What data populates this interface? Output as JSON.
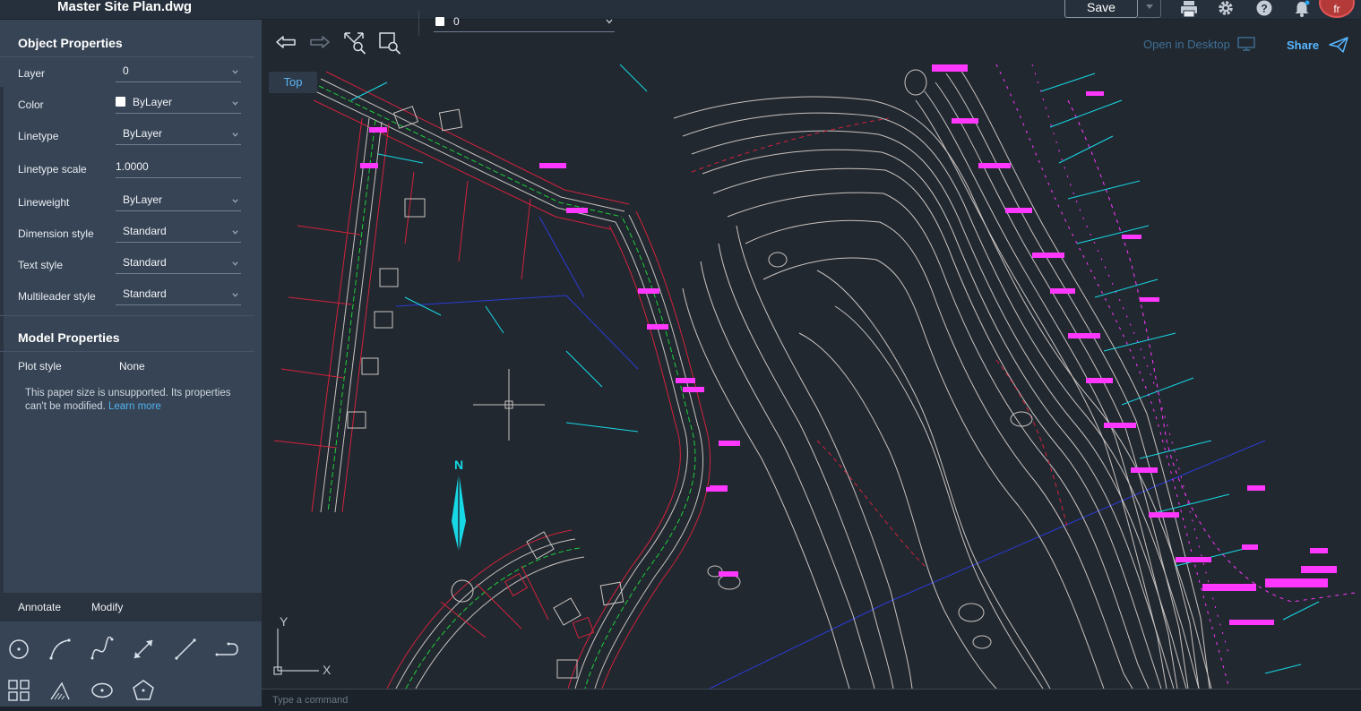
{
  "app": {
    "file_title": "Master Site Plan.dwg",
    "save_label": "Save",
    "avatar_initials": "fr",
    "open_desktop_label": "Open in Desktop",
    "share_label": "Share",
    "accent_color": "#58b6ff",
    "icons": [
      "print-icon",
      "gear-icon",
      "help-icon",
      "bell-icon"
    ]
  },
  "object_properties": {
    "title": "Object Properties",
    "rows": [
      {
        "label": "Layer",
        "value": "0"
      },
      {
        "label": "Color",
        "value": "ByLayer"
      },
      {
        "label": "Linetype",
        "value": "ByLayer"
      },
      {
        "label": "Linetype scale",
        "value": "1.0000"
      },
      {
        "label": "Lineweight",
        "value": "ByLayer"
      },
      {
        "label": "Dimension style",
        "value": "Standard"
      },
      {
        "label": "Text style",
        "value": "Standard"
      },
      {
        "label": "Multileader style",
        "value": "Standard"
      }
    ]
  },
  "model_properties": {
    "title": "Model Properties",
    "plot_style_label": "Plot style",
    "plot_style_value": "None",
    "note": "This paper size is unsupported. Its properties can't be modified.",
    "note_link": "Learn more"
  },
  "tool_palette": {
    "tabs": [
      "Annotate",
      "Modify"
    ],
    "tools": [
      "circle-tool-icon",
      "arc-tool-icon",
      "spline-tool-icon",
      "dimension-tool-icon",
      "line-tool-icon",
      "polyline-tool-icon",
      "grid-tool-icon",
      "hatch-tool-icon",
      "ellipse-tool-icon",
      "polygon-tool-icon"
    ]
  },
  "canvas_toolbar": {
    "layer_value": "0",
    "icons": [
      "undo-icon",
      "redo-icon",
      "zoom-extents-icon",
      "zoom-window-icon"
    ]
  },
  "canvas": {
    "view_label": "Top",
    "north_label": "N",
    "ucs_y": "Y",
    "ucs_x": "X",
    "colors": {
      "background": "#212830",
      "contours": "#c9c3c0",
      "property_lines": "#d3223b",
      "points": "#ff37ff",
      "leaders": "#17d9e6",
      "road_centerline": "#1fcf39",
      "boundary": "#2b3bd6"
    }
  },
  "command_line": {
    "placeholder": "Type a command"
  }
}
